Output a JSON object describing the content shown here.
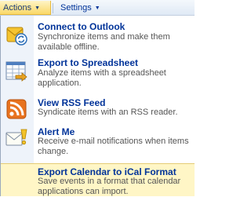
{
  "toolbar": {
    "actions_label": "Actions",
    "settings_label": "Settings",
    "caret": "▼"
  },
  "menu": {
    "items": [
      {
        "title": "Connect to Outlook",
        "description": "Synchronize items and make them available offline.",
        "icon": "outlook-icon"
      },
      {
        "title": "Export to Spreadsheet",
        "description": "Analyze items with a spreadsheet application.",
        "icon": "spreadsheet-icon"
      },
      {
        "title": "View RSS Feed",
        "description": "Syndicate items with an RSS reader.",
        "icon": "rss-icon"
      },
      {
        "title": "Alert Me",
        "description": "Receive e-mail notifications when items change.",
        "icon": "alert-icon"
      },
      {
        "title": "Export Calendar to iCal Format",
        "description": "Save events in a format that calendar applications can import.",
        "icon": ""
      }
    ]
  },
  "colors": {
    "title": "#003399",
    "highlight": "#fff6c6",
    "rss": "#e8731f"
  }
}
